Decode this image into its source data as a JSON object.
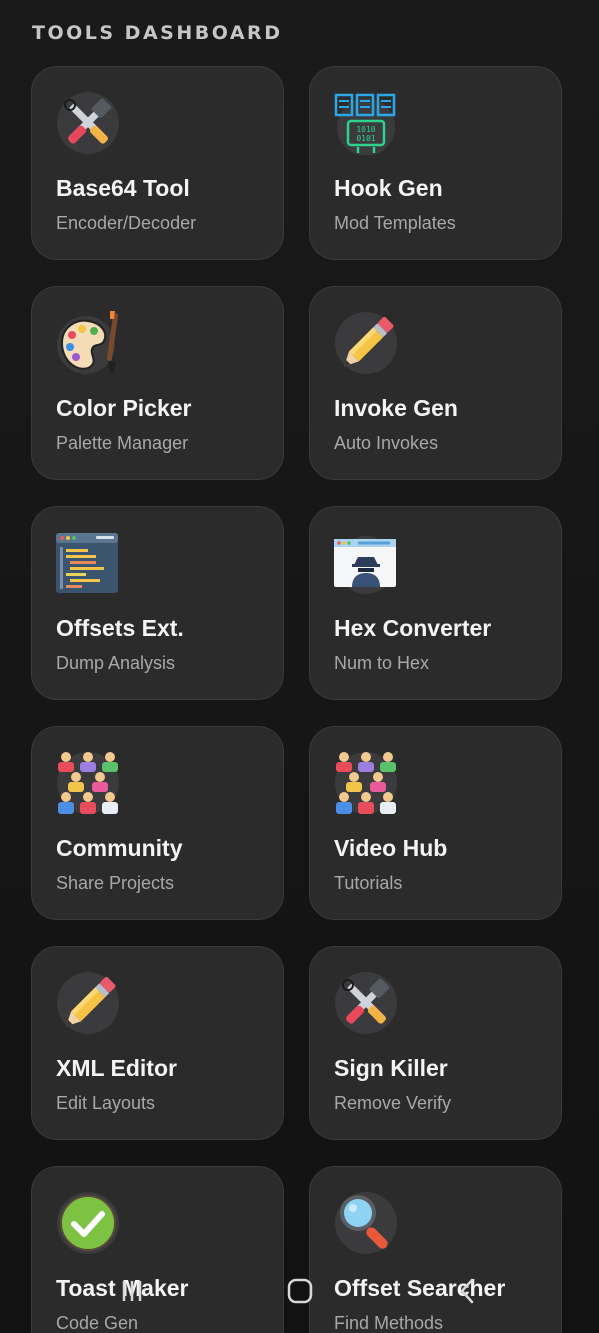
{
  "header": {
    "title": "TOOLS DASHBOARD"
  },
  "tools": [
    {
      "name": "Base64 Tool",
      "subtitle": "Encoder/Decoder",
      "icon": "tools-icon"
    },
    {
      "name": "Hook Gen",
      "subtitle": "Mod Templates",
      "icon": "binary-servers-icon"
    },
    {
      "name": "Color Picker",
      "subtitle": "Palette Manager",
      "icon": "palette-icon"
    },
    {
      "name": "Invoke Gen",
      "subtitle": "Auto Invokes",
      "icon": "pencil-icon"
    },
    {
      "name": "Offsets Ext.",
      "subtitle": "Dump Analysis",
      "icon": "code-window-icon"
    },
    {
      "name": "Hex Converter",
      "subtitle": "Num to Hex",
      "icon": "incognito-window-icon"
    },
    {
      "name": "Community",
      "subtitle": "Share Projects",
      "icon": "people-group-icon"
    },
    {
      "name": "Video Hub",
      "subtitle": "Tutorials",
      "icon": "people-group-icon"
    },
    {
      "name": "XML Editor",
      "subtitle": "Edit Layouts",
      "icon": "pencil-icon"
    },
    {
      "name": "Sign Killer",
      "subtitle": "Remove Verify",
      "icon": "tools-icon"
    },
    {
      "name": "Toast Maker",
      "subtitle": "Code Gen",
      "icon": "check-circle-icon"
    },
    {
      "name": "Offset Searcher",
      "subtitle": "Find Methods",
      "icon": "magnifier-icon"
    }
  ],
  "navbar": {
    "recent": "recent-apps-icon",
    "home": "home-icon",
    "back": "back-icon"
  }
}
